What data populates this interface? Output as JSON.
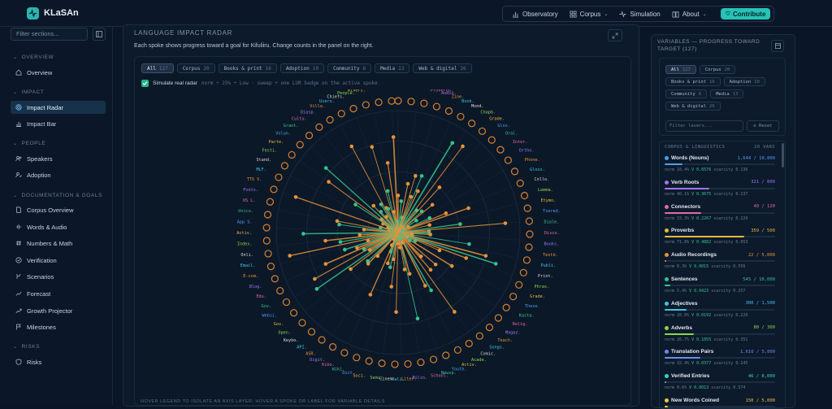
{
  "app": {
    "name": "KLaSAn"
  },
  "nav": {
    "items": [
      {
        "label": "Observatory",
        "icon": "bar-chart-icon"
      },
      {
        "label": "Corpus",
        "icon": "grid-icon"
      },
      {
        "label": "Simulation",
        "icon": "pulse-icon"
      },
      {
        "label": "About",
        "icon": "book-icon"
      }
    ],
    "contribute": "Contribute"
  },
  "sidebar": {
    "filter_placeholder": "Filter sections...",
    "sections": [
      {
        "title": "OVERVIEW",
        "items": [
          "Overview"
        ]
      },
      {
        "title": "IMPACT",
        "items": [
          "Impact Radar",
          "Impact Bar"
        ]
      },
      {
        "title": "PEOPLE",
        "items": [
          "Speakers",
          "Adoption"
        ]
      },
      {
        "title": "DOCUMENTATION & GOALS",
        "items": [
          "Corpus Overview",
          "Words & Audio",
          "Numbers & Math",
          "Verification",
          "Scenarios",
          "Forecast",
          "Growth Projector",
          "Milestones"
        ]
      },
      {
        "title": "RISKS",
        "items": [
          "Risks"
        ]
      }
    ],
    "active": "Impact Radar"
  },
  "main": {
    "title": "LANGUAGE IMPACT RADAR",
    "description": "Each spoke shows progress toward a goal for Kifuliiru. Change counts in the panel on the right.",
    "chips": [
      {
        "label": "All",
        "count": "127"
      },
      {
        "label": "Corpus",
        "count": "20"
      },
      {
        "label": "Books & print",
        "count": "16"
      },
      {
        "label": "Adoption",
        "count": "10"
      },
      {
        "label": "Community",
        "count": "6"
      },
      {
        "label": "Media",
        "count": "13"
      },
      {
        "label": "Web & digital",
        "count": "26"
      }
    ],
    "simulate_label": "Simulate real radar",
    "simulate_hint": "norm ÷ 25% ÷ Low · sweep ÷ one LUR badge on the active spoke",
    "footer": "HOVER LEGEND TO ISOLATE AN AXIS LAYER; HOVER A SPOKE OR LABEL FOR VARIABLE DETAILS"
  },
  "chart_data": {
    "type": "radar",
    "title": "LANGUAGE IMPACT RADAR",
    "spoke_count": 127,
    "visible_spoke_labels": [
      "Words",
      "Verb",
      "Sentences",
      "Proverbs",
      "Audio",
      "Zine",
      "Book",
      "Mond",
      "Chapb",
      "Grade",
      "Glos",
      "Oral",
      "Inter",
      "Ortho",
      "Phone",
      "Gloss",
      "Collo",
      "Lemma",
      "Etymo",
      "Tsered",
      "Diale",
      "Disco",
      "Books",
      "Textb",
      "Publi",
      "Print",
      "Phras",
      "Grade",
      "These",
      "Kasta",
      "Relig",
      "Magaz",
      "Teach",
      "Songs",
      "Comic",
      "Acade",
      "Activ",
      "Youth",
      "Newsp",
      "School",
      "Bilin",
      "Liter",
      "Pali",
      "Cinem",
      "Semi",
      "Soci",
      "Dict",
      "Wiki",
      "Kibo",
      "Digit",
      "ASR",
      "API",
      "Keybo",
      "Open",
      "Gov",
      "Websi",
      "Gov",
      "Edu",
      "Blog",
      "E-com",
      "Email",
      "Onli",
      "Index",
      "Activ",
      "App S",
      "Unico",
      "OS L",
      "Fonts",
      "TTS V",
      "MLF",
      "Stand",
      "Festi",
      "Parte",
      "Volun",
      "Grant",
      "Cultu",
      "Diasp",
      "Villa",
      "Users",
      "Chiefs",
      "People",
      "Rivers",
      "Hours",
      "Dance"
    ],
    "radial_max": 100
  },
  "right": {
    "title": "VARIABLES — PROGRESS TOWARD TARGET (127)",
    "chips": [
      {
        "label": "All",
        "count": "127"
      },
      {
        "label": "Corpus",
        "count": "20"
      },
      {
        "label": "Books & print",
        "count": "16"
      },
      {
        "label": "Adoption",
        "count": "10"
      },
      {
        "label": "Community",
        "count": "6"
      },
      {
        "label": "Media",
        "count": "13"
      },
      {
        "label": "Web & digital",
        "count": "26"
      }
    ],
    "search_placeholder": "Filter levers...",
    "reset": "⊘ Reset",
    "group": "CORPUS & LINGUISTICS",
    "group_count": "20 VARS",
    "variables": [
      {
        "name": "Words (Nouns)",
        "value": "1,644 / 10,000",
        "norm": "norm 16.4%",
        "v": "V 0.6576",
        "scarcity": "scarcity 0.136",
        "color": "#4f9df0",
        "fraction": 0.164
      },
      {
        "name": "Verb Roots",
        "value": "321 / 800",
        "norm": "norm 40.1%",
        "v": "V 0.3675",
        "scarcity": "scarcity 0.137",
        "color": "#a374f0",
        "fraction": 0.401
      },
      {
        "name": "Connectors",
        "value": "40 / 120",
        "norm": "norm 33.3%",
        "v": "V 0.2267",
        "scarcity": "scarcity 0.229",
        "color": "#e46aa5",
        "fraction": 0.333
      },
      {
        "name": "Proverbs",
        "value": "359 / 500",
        "norm": "norm 71.8%",
        "v": "V 0.4882",
        "scarcity": "scarcity 0.053",
        "color": "#e8b93a",
        "fraction": 0.718
      },
      {
        "name": "Audio Recordings",
        "value": "22 / 5,000",
        "norm": "norm 0.3%",
        "v": "V 0.0015",
        "scarcity": "scarcity 0.556",
        "color": "#e8913a",
        "fraction": 0.004
      },
      {
        "name": "Sentences",
        "value": "545 / 10,000",
        "norm": "norm 5.4%",
        "v": "V 0.0423",
        "scarcity": "scarcity 0.257",
        "color": "#35c48e",
        "fraction": 0.054
      },
      {
        "name": "Adjectives",
        "value": "300 / 1,500",
        "norm": "norm 20.0%",
        "v": "V 0.0192",
        "scarcity": "scarcity 0.220",
        "color": "#3fc5e0",
        "fraction": 0.2
      },
      {
        "name": "Adverbs",
        "value": "80 / 300",
        "norm": "norm 26.7%",
        "v": "V 0.1055",
        "scarcity": "scarcity 0.351",
        "color": "#8bd450",
        "fraction": 0.267
      },
      {
        "name": "Translation Pairs",
        "value": "1,610 / 5,000",
        "norm": "norm 32.4%",
        "v": "V 0.0377",
        "scarcity": "scarcity 0.145",
        "color": "#6b8cf0",
        "fraction": 0.324
      },
      {
        "name": "Verified Entries",
        "value": "46 / 8,000",
        "norm": "norm 0.6%",
        "v": "V 0.0013",
        "scarcity": "scarcity 0.574",
        "color": "#3ad0d0",
        "fraction": 0.006
      },
      {
        "name": "New Words Coined",
        "value": "150 / 5,000",
        "norm": "norm 3.0%",
        "v": "V 0.0120",
        "scarcity": "scarcity 0.300",
        "color": "#f0c83a",
        "fraction": 0.03
      }
    ]
  }
}
